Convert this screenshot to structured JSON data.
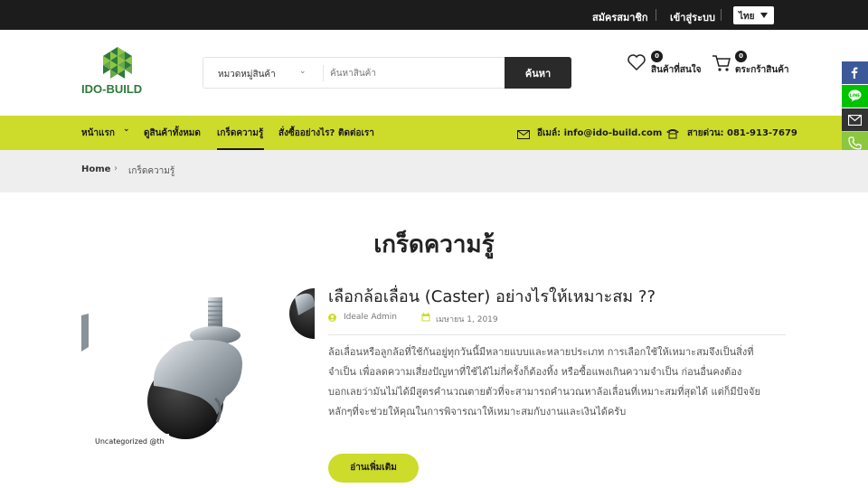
{
  "topbar": {
    "register": "สมัครสมาชิก",
    "login": "เข้าสู่ระบบ",
    "language": "ไทย"
  },
  "header": {
    "logo_text": "IDO-BUILD",
    "category_select": "หมวดหมู่สินค้า",
    "search_placeholder": "ค้นหาสินค้า",
    "search_button": "ค้นหา",
    "wishlist_count": "0",
    "wishlist_label": "สินค้าที่สนใจ",
    "cart_count": "0",
    "cart_label": "ตระกร้าสินค้า"
  },
  "nav": {
    "items": [
      {
        "label": "หน้าแรก"
      },
      {
        "label": "ดูสินค้าทั้งหมด"
      },
      {
        "label": "เกร็ดความรู้"
      },
      {
        "label": "สั่งซื้ออย่างไร?"
      },
      {
        "label": "ติดต่อเรา"
      }
    ],
    "email": "อีเมล์: info@ido-build.com",
    "hotline": "สายด่วน: 081-913-7679"
  },
  "social": {
    "icons": [
      "facebook-icon",
      "line-icon",
      "email-icon",
      "phone-icon"
    ],
    "colors": [
      "#3b5998",
      "#00c300",
      "#333333",
      "#8dc63f"
    ]
  },
  "breadcrumb": {
    "home": "Home",
    "current": "เกร็ดความรู้"
  },
  "main": {
    "title": "เกร็ดความรู้",
    "post": {
      "title": "เลือกล้อเลื่อน (Caster) อย่างไรให้เหมาะสม ??",
      "author": "Ideale Admin",
      "date": "เมษายน 1, 2019",
      "category_tag": "Uncategorized @th",
      "excerpt_lines": [
        "ล้อเลื่อนหรือลูกล้อที่ใช้กันอยู่ทุกวันนี้มีหลายแบบและหลายประเภท การเลือกใช้ให้เหมาะสมจึงเป็นสิ่งที่",
        "จำเป็น เพื่อลดความเสี่ยงปัญหาที่ใช้ได้ไม่กี่ครั้งก็ต้องทิ้ง หรือซื้อแพงเกินความจำเป็น ก่อนอื่นคงต้อง",
        "บอกเลยว่ามันไม่ได้มีสูตรคำนวณตายตัวที่จะสามารถคำนวณหาล้อเลื่อนที่เหมาะสมที่สุดได้ แต่ก็มีปัจจัย",
        "หลักๆที่จะช่วยให้คุณในการพิจารณาให้เหมาะสมกับงานและเงินได้ครับ"
      ],
      "read_more": "อ่านเพิ่มเติม"
    }
  },
  "colors": {
    "accent": "#cddb2b",
    "topbar": "#1c1c1c",
    "logo_green": "#2e7a3c"
  }
}
